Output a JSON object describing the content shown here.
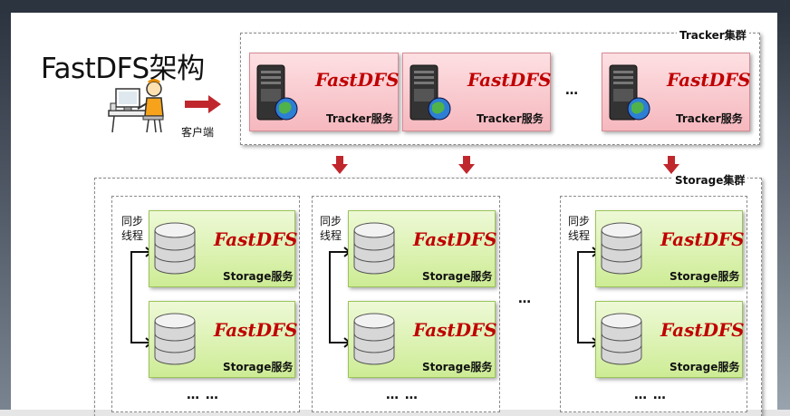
{
  "title": "FastDFS架构",
  "client": {
    "label": "客户端"
  },
  "tracker_cluster": {
    "label": "Tracker集群",
    "ellipsis": "…",
    "nodes": [
      {
        "brand": "FastDFS",
        "service": "Tracker服务"
      },
      {
        "brand": "FastDFS",
        "service": "Tracker服务"
      },
      {
        "brand": "FastDFS",
        "service": "Tracker服务"
      }
    ]
  },
  "storage_cluster": {
    "label": "Storage集群",
    "group_ellipsis": "…",
    "groups": [
      {
        "sync_label_1": "同步",
        "sync_label_2": "线程",
        "ellipsis": "…  …",
        "nodes": [
          {
            "brand": "FastDFS",
            "service": "Storage服务"
          },
          {
            "brand": "FastDFS",
            "service": "Storage服务"
          }
        ]
      },
      {
        "sync_label_1": "同步",
        "sync_label_2": "线程",
        "ellipsis": "…  …",
        "nodes": [
          {
            "brand": "FastDFS",
            "service": "Storage服务"
          },
          {
            "brand": "FastDFS",
            "service": "Storage服务"
          }
        ]
      },
      {
        "sync_label_1": "同步",
        "sync_label_2": "线程",
        "ellipsis": "…  …",
        "nodes": [
          {
            "brand": "FastDFS",
            "service": "Storage服务"
          },
          {
            "brand": "FastDFS",
            "service": "Storage服务"
          }
        ]
      }
    ]
  },
  "colors": {
    "arrow": "#c0272d",
    "tracker_fill": "#f5b8be",
    "storage_fill": "#cdec95",
    "brand_text": "#c00000"
  },
  "icons": {
    "client": "person-at-computer-icon",
    "tracker": "server-globe-icon",
    "storage": "database-disk-icon"
  }
}
